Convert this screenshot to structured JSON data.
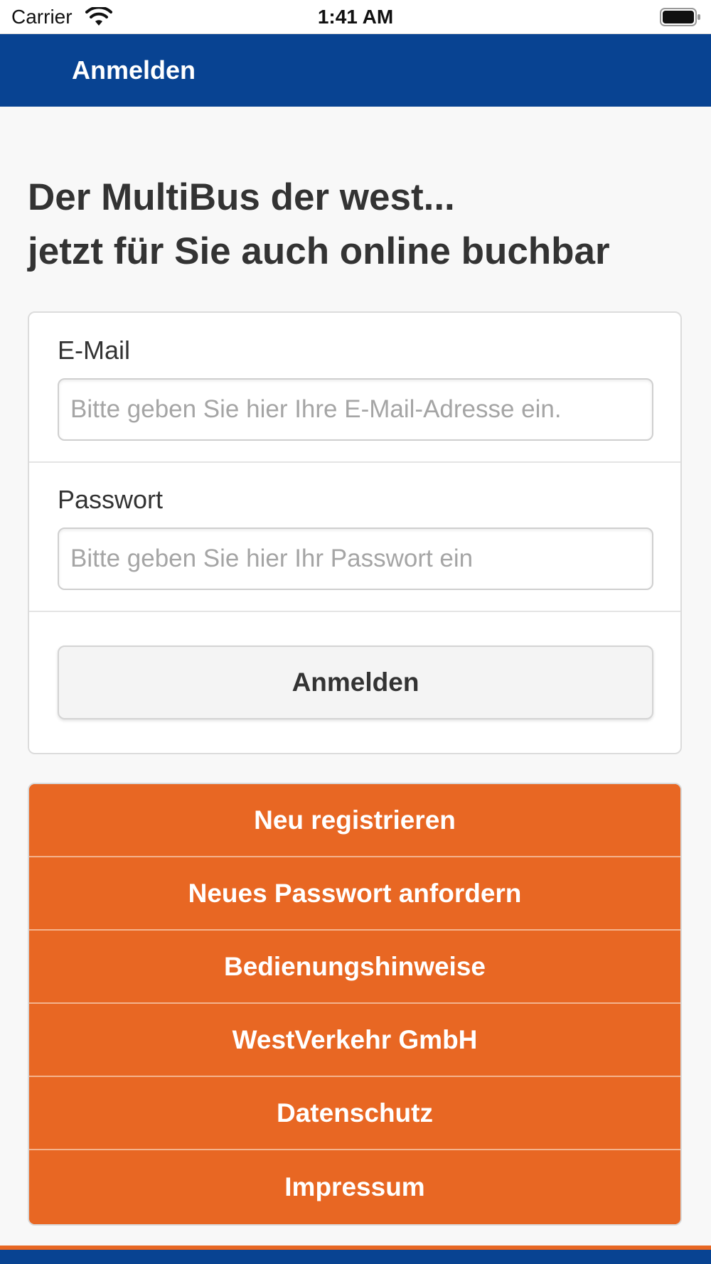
{
  "status_bar": {
    "carrier": "Carrier",
    "time": "1:41 AM",
    "wifi_icon": "wifi-icon",
    "battery_icon": "battery-icon"
  },
  "nav": {
    "title": "Anmelden",
    "color": "#084392"
  },
  "headline": {
    "line1": "Der MultiBus der west...",
    "line2": "jetzt für Sie auch online buchbar"
  },
  "login_form": {
    "email_label": "E-Mail",
    "email_placeholder": "Bitte geben Sie hier Ihre E-Mail-Adresse ein.",
    "email_value": "",
    "password_label": "Passwort",
    "password_placeholder": "Bitte geben Sie hier Ihr Passwort ein",
    "password_value": "",
    "submit_label": "Anmelden"
  },
  "menu": {
    "accent_color": "#e86723",
    "items": [
      {
        "label": "Neu registrieren"
      },
      {
        "label": "Neues Passwort anfordern"
      },
      {
        "label": "Bedienungshinweise"
      },
      {
        "label": "WestVerkehr GmbH"
      },
      {
        "label": "Datenschutz"
      },
      {
        "label": "Impressum"
      }
    ]
  }
}
